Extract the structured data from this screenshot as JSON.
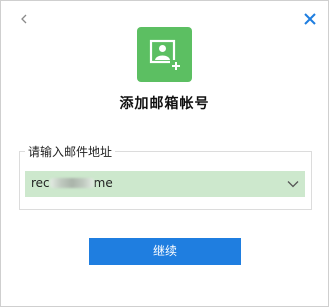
{
  "window": {
    "back_icon": "chevron-left-icon",
    "close_icon": "close-icon"
  },
  "header": {
    "logo_icon": "add-account-icon",
    "title": "添加邮箱帐号"
  },
  "form": {
    "email_label": "请输入邮件地址",
    "email_value_prefix": "rec",
    "email_value_suffix": "me",
    "dropdown_icon": "chevron-down-icon"
  },
  "actions": {
    "continue_label": "继续"
  },
  "colors": {
    "accent": "#1f7ee0",
    "logo": "#5cbf62",
    "selection": "#cde8cd"
  }
}
